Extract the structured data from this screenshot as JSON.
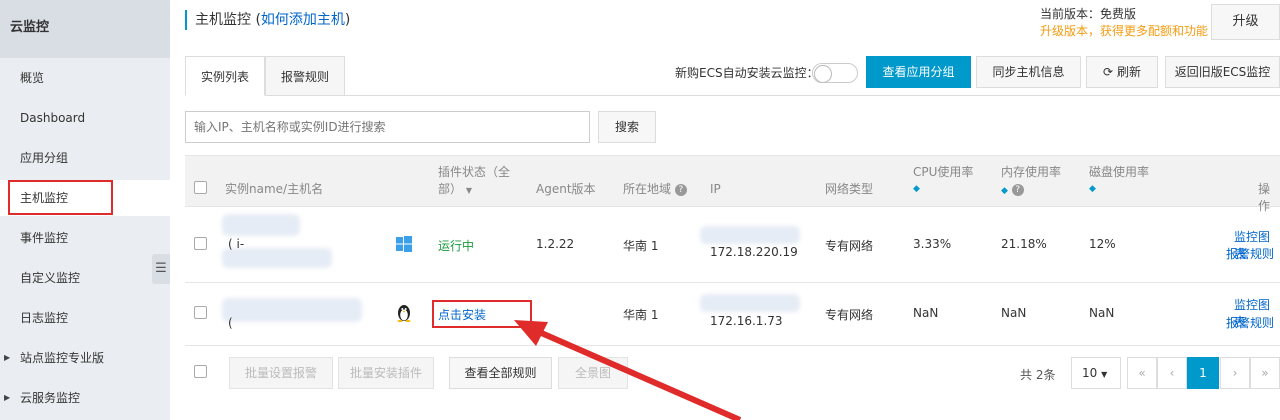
{
  "sidebar": {
    "title": "云监控",
    "items": [
      {
        "label": "概览",
        "expand": false
      },
      {
        "label": "Dashboard",
        "expand": false
      },
      {
        "label": "应用分组",
        "expand": false
      },
      {
        "label": "主机监控",
        "expand": false,
        "active": true
      },
      {
        "label": "事件监控",
        "expand": false
      },
      {
        "label": "自定义监控",
        "expand": false
      },
      {
        "label": "日志监控",
        "expand": false
      },
      {
        "label": "站点监控专业版",
        "expand": true
      },
      {
        "label": "云服务监控",
        "expand": true
      }
    ],
    "collapse_icon": "collapse-icon"
  },
  "header": {
    "title": "主机监控",
    "title_paren_open": "(",
    "link": "如何添加主机",
    "title_paren_close": ")",
    "version_current": "当前版本：免费版",
    "version_upgrade_tip": "升级版本，获得更多配额和功能",
    "upgrade_button": "升级"
  },
  "tabs": [
    {
      "label": "实例列表",
      "active": true
    },
    {
      "label": "报警规则",
      "active": false
    }
  ],
  "toolbar": {
    "auto_install_label": "新购ECS自动安装云监控：",
    "view_groups": "查看应用分组",
    "sync_hosts": "同步主机信息",
    "refresh": "刷新",
    "back_old": "返回旧版ECS监控"
  },
  "search": {
    "placeholder": "输入IP、主机名称或实例ID进行搜索",
    "button": "搜索"
  },
  "table": {
    "columns": {
      "name": "实例name/主机名",
      "plugin_status_1": "插件状态（全",
      "plugin_status_2": "部）",
      "agent": "Agent版本",
      "region": "所在地域",
      "ip": "IP",
      "network": "网络类型",
      "cpu": "CPU使用率",
      "mem": "内存使用率",
      "disk": "磁盘使用率",
      "ops": "操作"
    },
    "rows": [
      {
        "name_fragment": "( i-",
        "os": "windows-icon",
        "plugin": "运行中",
        "agent": "1.2.22",
        "region": "华南 1",
        "ip": "172.18.220.19",
        "network": "专有网络",
        "cpu": "3.33%",
        "mem": "21.18%",
        "disk": "12%",
        "op1": "监控图表",
        "op2": "报警规则"
      },
      {
        "name_fragment": "(",
        "os": "linux-icon",
        "plugin": "点击安装",
        "agent": "",
        "region": "华南 1",
        "ip": "172.16.1.73",
        "network": "专有网络",
        "cpu": "NaN",
        "mem": "NaN",
        "disk": "NaN",
        "op1": "监控图表",
        "op2": "报警规则"
      }
    ]
  },
  "footer": {
    "batch_alarm": "批量设置报警",
    "batch_install": "批量安装插件",
    "view_all_rules": "查看全部规则",
    "full_view": "全景图",
    "total": "共 2条",
    "page_size": "10",
    "first": "«",
    "prev": "‹",
    "current_page": "1",
    "next": "›",
    "last": "»"
  },
  "colors": {
    "primary": "#0099cc",
    "annotation": "#e02b2b",
    "running": "#1a9b3f",
    "upgrade": "#f39c12"
  }
}
